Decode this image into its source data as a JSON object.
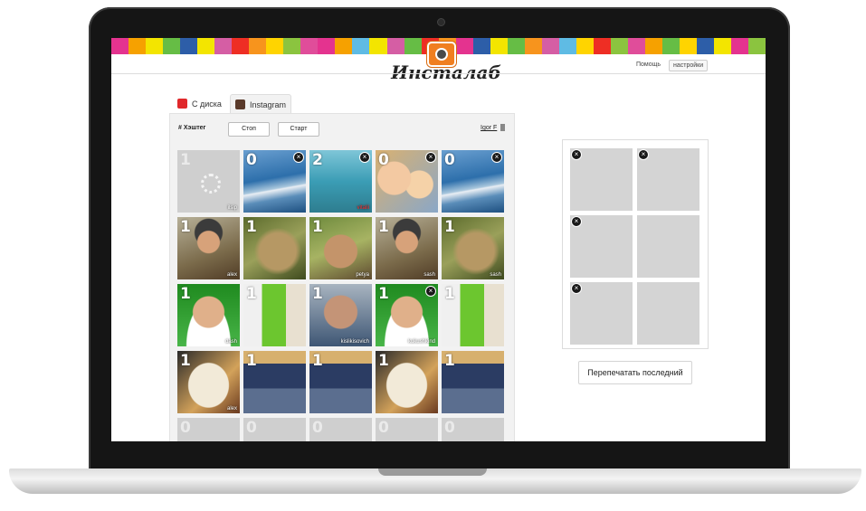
{
  "app": {
    "logo_text": "Инсталаб",
    "nav_help": "Помощь",
    "nav_settings": "настройки"
  },
  "tabs": [
    {
      "label": "С диска",
      "active": false
    },
    {
      "label": "Instagram",
      "active": true
    }
  ],
  "toolbar": {
    "hashtag_label": "# Хэштег",
    "stop_label": "Стоп",
    "start_label": "Старт",
    "user_name": "Igor F"
  },
  "grid": [
    {
      "count": "1",
      "user": "ilsip",
      "photo": "pending",
      "pending": true,
      "remove": false
    },
    {
      "count": "0",
      "user": "",
      "photo": "plane",
      "pending": false,
      "remove": true
    },
    {
      "count": "2",
      "user": "vitalii",
      "photo": "plane2",
      "pending": false,
      "remove": true,
      "user_red": true
    },
    {
      "count": "0",
      "user": "",
      "photo": "family",
      "pending": false,
      "remove": true
    },
    {
      "count": "0",
      "user": "",
      "photo": "plane",
      "pending": false,
      "remove": true
    },
    {
      "count": "1",
      "user": "alex",
      "photo": "pilot",
      "pending": false,
      "remove": false
    },
    {
      "count": "1",
      "user": "",
      "photo": "eagle",
      "pending": false,
      "remove": false
    },
    {
      "count": "1",
      "user": "petya",
      "photo": "monkey",
      "pending": false,
      "remove": false
    },
    {
      "count": "1",
      "user": "sash",
      "photo": "pilot",
      "pending": false,
      "remove": false
    },
    {
      "count": "1",
      "user": "sash",
      "photo": "eagle",
      "pending": false,
      "remove": false
    },
    {
      "count": "1",
      "user": "dash",
      "photo": "man-green",
      "pending": false,
      "remove": false
    },
    {
      "count": "1",
      "user": "",
      "photo": "kiosk",
      "pending": false,
      "remove": false
    },
    {
      "count": "1",
      "user": "kislikisovich",
      "photo": "oldman",
      "pending": false,
      "remove": false
    },
    {
      "count": "1",
      "user": "kukushkind",
      "photo": "man-green",
      "pending": false,
      "remove": true
    },
    {
      "count": "1",
      "user": "",
      "photo": "kiosk",
      "pending": false,
      "remove": false
    },
    {
      "count": "1",
      "user": "alex",
      "photo": "cat",
      "pending": false,
      "remove": false
    },
    {
      "count": "1",
      "user": "",
      "photo": "crowd",
      "pending": false,
      "remove": false
    },
    {
      "count": "1",
      "user": "",
      "photo": "crowd",
      "pending": false,
      "remove": false
    },
    {
      "count": "1",
      "user": "",
      "photo": "cat",
      "pending": false,
      "remove": false
    },
    {
      "count": "1",
      "user": "",
      "photo": "crowd",
      "pending": false,
      "remove": false
    },
    {
      "count": "0",
      "user": "",
      "photo": "pending",
      "pending": true,
      "remove": false,
      "cut": true
    },
    {
      "count": "0",
      "user": "",
      "photo": "pending",
      "pending": true,
      "remove": false,
      "cut": true
    },
    {
      "count": "0",
      "user": "",
      "photo": "pending",
      "pending": true,
      "remove": false,
      "cut": true
    },
    {
      "count": "0",
      "user": "",
      "photo": "pending",
      "pending": true,
      "remove": false,
      "cut": true
    },
    {
      "count": "0",
      "user": "",
      "photo": "pending",
      "pending": true,
      "remove": false,
      "cut": true
    }
  ],
  "print_queue": [
    {
      "photo": "pilot",
      "remove": true
    },
    {
      "photo": "eagle",
      "remove": true
    },
    {
      "photo": "cat",
      "remove": true
    },
    {
      "photo": "empty",
      "remove": false
    },
    {
      "photo": "crowd",
      "remove": true
    },
    {
      "photo": "empty",
      "remove": false
    }
  ],
  "reprint_label": "Перепечатать последний",
  "colors": {
    "stripe": [
      "#e4338f",
      "#f6a100",
      "#f3e500",
      "#66bd45",
      "#2d5ea8",
      "#f3e500",
      "#d55ea4",
      "#ee2e24",
      "#f7941d",
      "#ffd400",
      "#8bc43f",
      "#e04d9a",
      "#e4338f",
      "#f6a100",
      "#5fbbe4",
      "#f3e500",
      "#d55ea4",
      "#66bd45",
      "#ee2e24",
      "#f7941d",
      "#e4338f",
      "#2d5ea8",
      "#f3e500",
      "#66bd45",
      "#f7941d",
      "#d55ea4",
      "#5fbbe4",
      "#ffd400",
      "#ee2e24",
      "#8bc43f",
      "#e04d9a",
      "#f6a100",
      "#66bd45",
      "#ffd400",
      "#2d5ea8",
      "#f3e500",
      "#e4338f",
      "#8bc43f"
    ],
    "disk_tab_icon": "#e0282b",
    "instagram_tab_icon": "#5a3a2a"
  }
}
